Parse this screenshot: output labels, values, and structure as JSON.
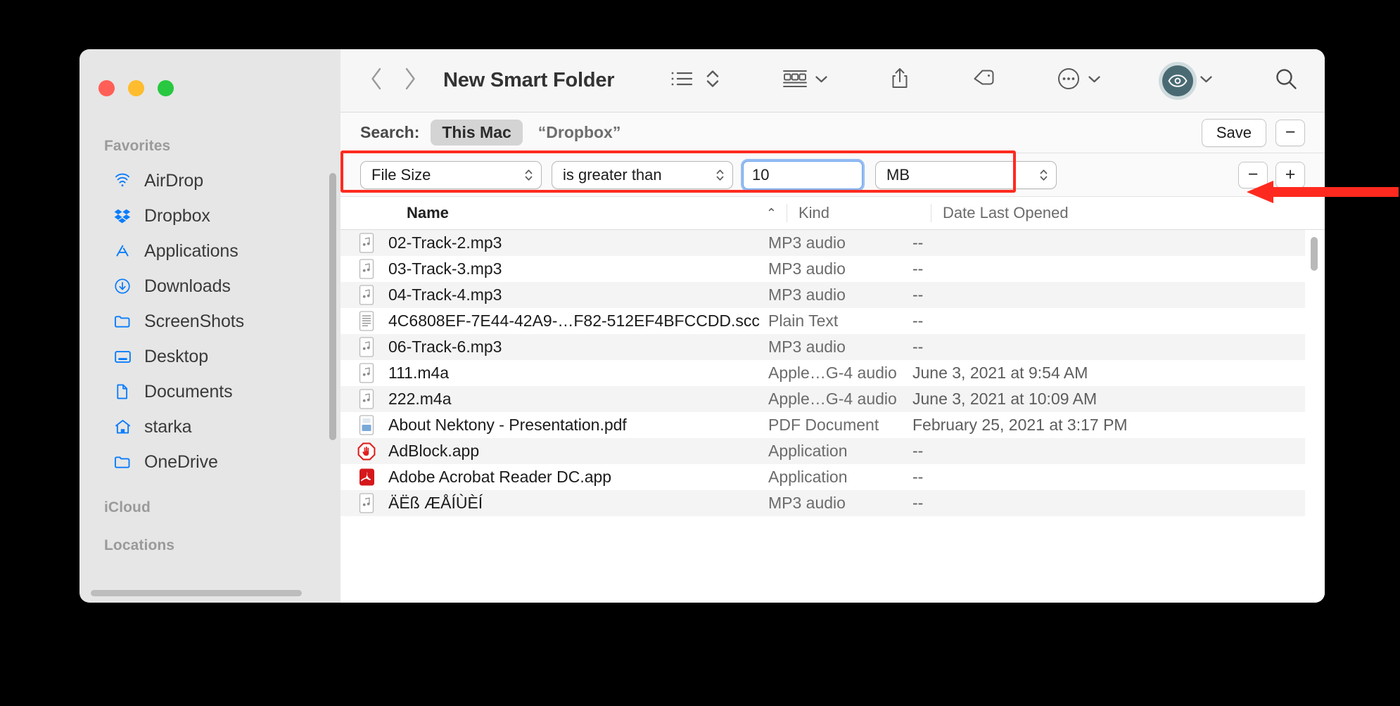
{
  "window": {
    "title": "New Smart Folder",
    "traffic_lights": [
      "close",
      "minimize",
      "maximize"
    ]
  },
  "toolbar": {
    "back_icon": "chevron-left-icon",
    "forward_icon": "chevron-right-icon",
    "view_list_icon": "list-view-icon",
    "view_sort_icon": "sort-chevrons-icon",
    "group_icon": "group-by-icon",
    "group_chevron_icon": "chevron-down-icon",
    "share_icon": "share-icon",
    "tag_icon": "tag-icon",
    "more_icon": "more-ellipsis-icon",
    "more_chevron_icon": "chevron-down-icon",
    "quicklook_icon": "eye-icon",
    "quicklook_chevron_icon": "chevron-down-icon",
    "search_icon": "search-icon",
    "accent_color": "#4a6a73"
  },
  "sidebar": {
    "groups": [
      {
        "title": "Favorites",
        "items": [
          {
            "label": "AirDrop",
            "icon": "airdrop-icon"
          },
          {
            "label": "Dropbox",
            "icon": "dropbox-icon"
          },
          {
            "label": "Applications",
            "icon": "applications-icon"
          },
          {
            "label": "Downloads",
            "icon": "downloads-icon"
          },
          {
            "label": "ScreenShots",
            "icon": "folder-icon"
          },
          {
            "label": "Desktop",
            "icon": "desktop-icon"
          },
          {
            "label": "Documents",
            "icon": "document-icon"
          },
          {
            "label": "starka",
            "icon": "home-icon"
          },
          {
            "label": "OneDrive",
            "icon": "folder-icon"
          }
        ]
      },
      {
        "title": "iCloud",
        "items": []
      },
      {
        "title": "Locations",
        "items": []
      }
    ],
    "icon_color": "#0a7dfb",
    "background": "#e6e6e6"
  },
  "search_bar": {
    "label": "Search:",
    "scopes": [
      {
        "label": "This Mac",
        "selected": true
      },
      {
        "label": "“Dropbox”",
        "selected": false
      }
    ],
    "save_label": "Save",
    "remove_label": "−"
  },
  "criteria": {
    "attribute": "File Size",
    "operator": "is greater than",
    "value": "10",
    "unit": "MB",
    "remove_label": "−",
    "add_label": "+",
    "highlight_color": "#ff2a1f",
    "focus_ring_color": "#468beb"
  },
  "columns": {
    "name": "Name",
    "kind": "Kind",
    "date": "Date Last Opened",
    "sort_arrow": "⌃"
  },
  "files": [
    {
      "name": "02-Track-2.mp3",
      "kind": "MP3 audio",
      "date": "--",
      "icon": "music-file-icon"
    },
    {
      "name": "03-Track-3.mp3",
      "kind": "MP3 audio",
      "date": "--",
      "icon": "music-file-icon"
    },
    {
      "name": "04-Track-4.mp3",
      "kind": "MP3 audio",
      "date": "--",
      "icon": "music-file-icon"
    },
    {
      "name": "4C6808EF-7E44-42A9-…F82-512EF4BFCCDD.scc",
      "kind": "Plain Text",
      "date": "--",
      "icon": "text-file-icon"
    },
    {
      "name": "06-Track-6.mp3",
      "kind": "MP3 audio",
      "date": "--",
      "icon": "music-file-icon"
    },
    {
      "name": "111.m4a",
      "kind": "Apple…G-4 audio",
      "date": "June 3, 2021 at 9:54 AM",
      "icon": "music-file-icon"
    },
    {
      "name": "222.m4a",
      "kind": "Apple…G-4 audio",
      "date": "June 3, 2021 at 10:09 AM",
      "icon": "music-file-icon"
    },
    {
      "name": "About Nektony - Presentation.pdf",
      "kind": "PDF Document",
      "date": "February 25, 2021 at 3:17 PM",
      "icon": "pdf-file-icon"
    },
    {
      "name": "AdBlock.app",
      "kind": "Application",
      "date": "--",
      "icon": "adblock-icon"
    },
    {
      "name": "Adobe Acrobat Reader DC.app",
      "kind": "Application",
      "date": "--",
      "icon": "acrobat-icon"
    },
    {
      "name": "ÄËß ÆÅÍÙÈÍ",
      "kind": "MP3 audio",
      "date": "--",
      "icon": "music-file-icon"
    }
  ],
  "annotation": {
    "arrow": "left-pointing-arrow",
    "color": "#ff2a1f"
  }
}
